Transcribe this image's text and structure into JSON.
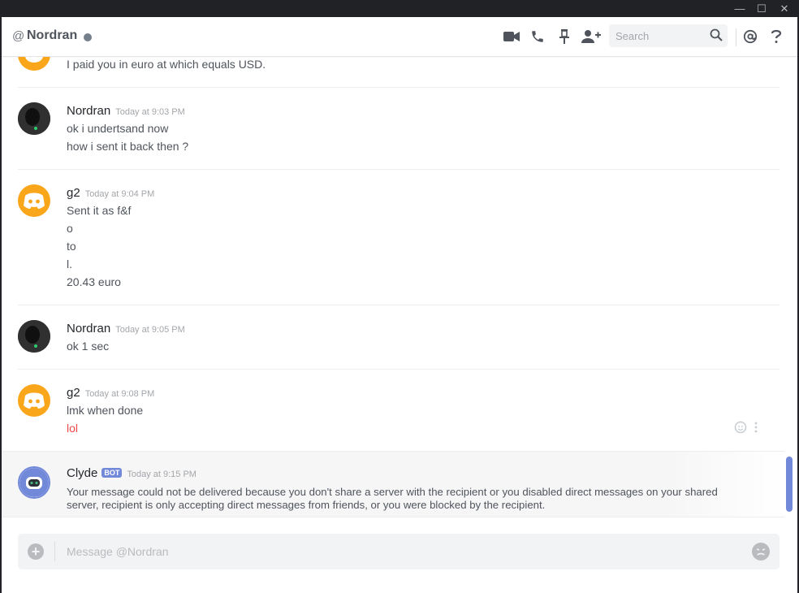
{
  "window": {
    "minimize": "—",
    "maximize": "☐",
    "close": "✕"
  },
  "header": {
    "at_symbol": "@",
    "channel_name": "Nordran",
    "search_placeholder": "Search",
    "icons": [
      "video-call-icon",
      "voice-call-icon",
      "pin-icon",
      "add-friend-icon",
      "search-icon",
      "mention-icon",
      "help-icon"
    ]
  },
  "messages": [
    {
      "partial": true,
      "lines": [
        "I paid you in euro at which equals USD."
      ]
    },
    {
      "author": "Nordran",
      "timestamp": "Today at 9:03 PM",
      "lines": [
        "ok i undertsand now",
        "how i sent it back then ?"
      ]
    },
    {
      "author": "g2",
      "timestamp": "Today at 9:04 PM",
      "lines": [
        "Sent it as f&f",
        "o",
        "to",
        "l.",
        "20.43 euro"
      ]
    },
    {
      "author": "Nordran",
      "timestamp": "Today at 9:05 PM",
      "lines": [
        "ok 1 sec"
      ]
    },
    {
      "author": "g2",
      "timestamp": "Today at 9:08 PM",
      "lines": [
        "lmk when done",
        "lol"
      ],
      "last_line_color": "#f04747"
    },
    {
      "author": "Clyde",
      "badge": "BOT",
      "timestamp": "Today at 9:15 PM",
      "lines": [
        "Your message could not be delivered because you don't share a server with the recipient or you disabled direct messages on your shared",
        "server, recipient is only accepting direct messages from friends, or you were blocked by the recipient."
      ]
    }
  ],
  "composer": {
    "placeholder": "Message @Nordran"
  },
  "colors": {
    "accent": "#7289da",
    "discord_orange": "#faa61a",
    "red_text": "#f04747"
  }
}
